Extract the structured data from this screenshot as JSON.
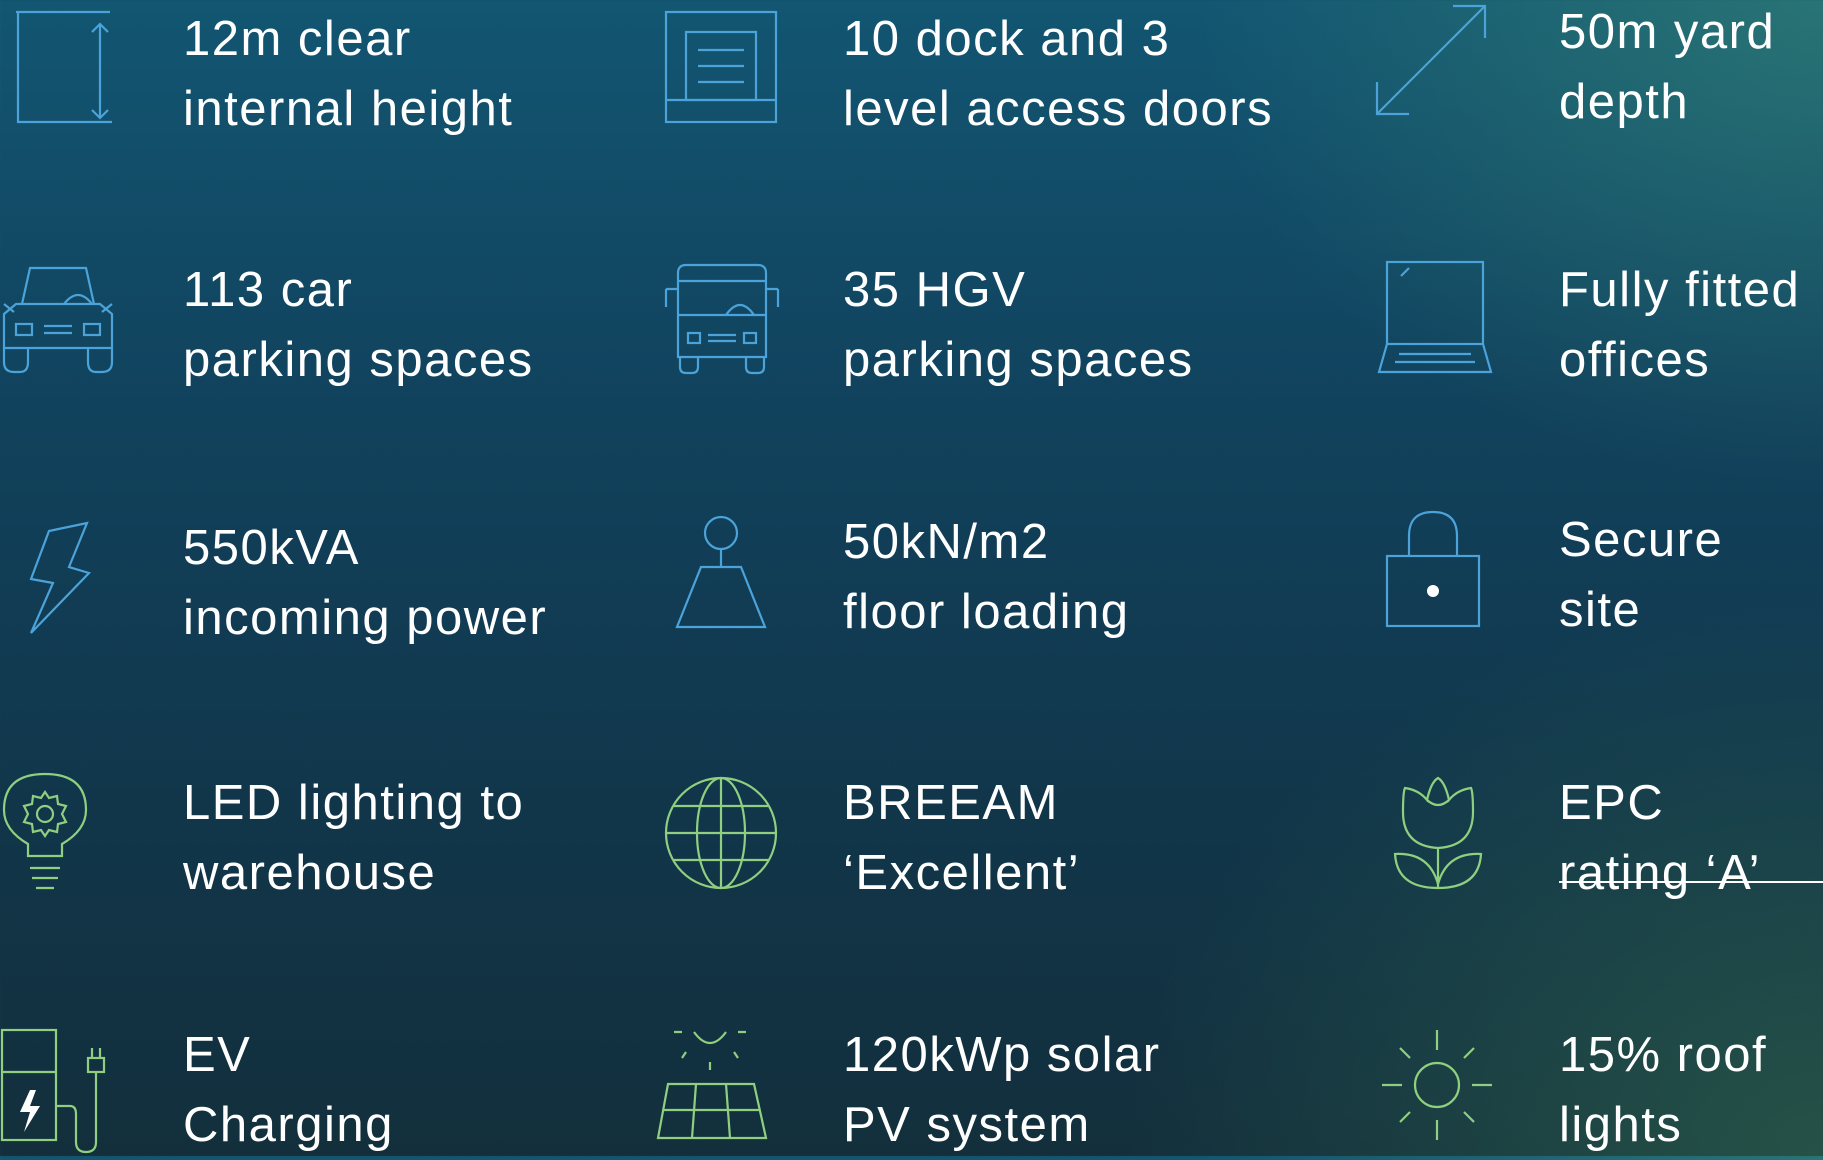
{
  "colors": {
    "icon_blue": "#4ba3d9",
    "icon_green": "#8fcf7f",
    "text": "#ffffff"
  },
  "features": [
    {
      "icon": "height-icon",
      "line1": "12m clear",
      "line2": "internal height"
    },
    {
      "icon": "dock-door-icon",
      "line1": "10 dock and 3",
      "line2": "level access doors"
    },
    {
      "icon": "diagonal-arrow-icon",
      "line1": "50m yard",
      "line2": "depth"
    },
    {
      "icon": "car-icon",
      "line1": "113 car",
      "line2": "parking spaces"
    },
    {
      "icon": "truck-icon",
      "line1": "35 HGV",
      "line2": "parking spaces"
    },
    {
      "icon": "laptop-icon",
      "line1": "Fully fitted",
      "line2": "offices"
    },
    {
      "icon": "lightning-icon",
      "line1": "550kVA",
      "line2": "incoming power"
    },
    {
      "icon": "floor-weight-icon",
      "line1": "50kN/m2",
      "line2": "floor loading"
    },
    {
      "icon": "padlock-icon",
      "line1": "Secure",
      "line2": "site"
    },
    {
      "icon": "lightbulb-gear-icon",
      "line1": "LED lighting to",
      "line2": "warehouse"
    },
    {
      "icon": "globe-icon",
      "line1": "BREEAM",
      "line2": "‘Excellent’"
    },
    {
      "icon": "tulip-icon",
      "line1": "EPC",
      "line2": "rating ‘A’"
    },
    {
      "icon": "ev-charger-icon",
      "line1": "EV",
      "line2": "Charging"
    },
    {
      "icon": "solar-panel-icon",
      "line1": "120kWp solar",
      "line2": "PV system"
    },
    {
      "icon": "sun-icon",
      "line1": "15% roof",
      "line2": "lights"
    }
  ]
}
